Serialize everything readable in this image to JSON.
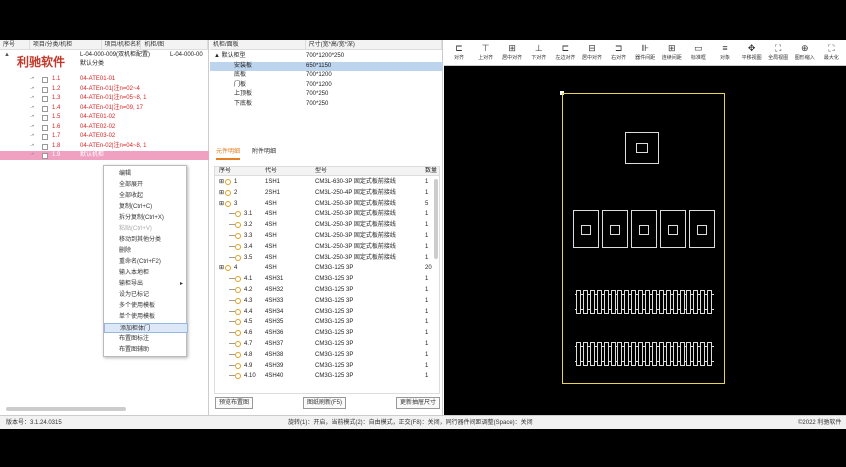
{
  "left": {
    "headers": [
      "序号",
      "项目/分类/机柜",
      "项目/机柜名称",
      "机柜/图"
    ],
    "logo": "利驰软件",
    "project_row": {
      "col1": "L-04-000-009(双机柜配置)",
      "col2": "L-04-000-00"
    },
    "sub_row": "默认分类",
    "rows": [
      {
        "no": "1.1",
        "name": "04-ATE01-01"
      },
      {
        "no": "1.2",
        "name": "04-ATEn-01|注n=02~4"
      },
      {
        "no": "1.3",
        "name": "04-ATEn-01|注n=05~8, 1"
      },
      {
        "no": "1.4",
        "name": "04-ATEn-01|注n=09, 17"
      },
      {
        "no": "1.5",
        "name": "04-ATE01-02"
      },
      {
        "no": "1.6",
        "name": "04-ATE02-02"
      },
      {
        "no": "1.7",
        "name": "04-ATE03-02"
      },
      {
        "no": "1.8",
        "name": "04-ATEn-02|注n=04~8, 1"
      },
      {
        "no": "1.9",
        "name": "默认机柜"
      }
    ]
  },
  "context_menu": {
    "items": [
      {
        "label": "编辑",
        "disabled": false
      },
      {
        "label": "全部展开",
        "disabled": false
      },
      {
        "label": "全部收起",
        "disabled": false
      },
      {
        "label": "复制(Ctrl+C)",
        "disabled": false
      },
      {
        "label": "拆分复制(Ctrl+X)",
        "disabled": false
      },
      {
        "label": "粘贴(Ctrl+V)",
        "disabled": true
      },
      {
        "label": "移动到其他分类",
        "disabled": false
      },
      {
        "label": "删除",
        "disabled": false
      },
      {
        "label": "重命名(Ctrl+F2)",
        "disabled": false
      },
      {
        "label": "输入本地柜",
        "disabled": false
      },
      {
        "label": "输柜导出",
        "disabled": false,
        "submenu": true
      },
      {
        "label": "设为已标记",
        "disabled": false
      },
      {
        "label": "多个使用模板",
        "disabled": false
      },
      {
        "label": "单个使用模板",
        "disabled": false
      },
      {
        "label": "添加柜体门",
        "disabled": false,
        "highlight": true
      },
      {
        "label": "布置图标注",
        "disabled": false
      },
      {
        "label": "布置图辅助",
        "disabled": false
      }
    ]
  },
  "middle": {
    "headers": [
      "机柜/面板",
      "尺寸(宽*高/宽*深)"
    ],
    "rows": [
      {
        "a": "▲ 默认柜型",
        "b": "700*1200*250"
      },
      {
        "a": "安装板",
        "b": "650*1150",
        "selected": true
      },
      {
        "a": "底板",
        "b": "700*1200"
      },
      {
        "a": "门板",
        "b": "700*1200"
      },
      {
        "a": "上顶板",
        "b": "700*250"
      },
      {
        "a": "下底板",
        "b": "700*250"
      }
    ],
    "tabs": [
      "元件明细",
      "附件明细"
    ],
    "table_headers": [
      "序号",
      "代号",
      "型号",
      "数量"
    ],
    "components": [
      {
        "no": "1",
        "code": "1SH1",
        "model": "CM3L-630-3P 固定式板前接线",
        "qty": "1"
      },
      {
        "no": "2",
        "code": "2SH1",
        "model": "CM3L-250-4P 固定式板前接线",
        "qty": "1"
      },
      {
        "no": "3",
        "code": "4SH",
        "model": "CM3L-250-3P 固定式板前接线",
        "qty": "5"
      },
      {
        "no": "3.1",
        "code": "4SH",
        "model": "CM3L-250-3P 固定式板前接线",
        "qty": "1"
      },
      {
        "no": "3.2",
        "code": "4SH",
        "model": "CM3L-250-3P 固定式板前接线",
        "qty": "1"
      },
      {
        "no": "3.3",
        "code": "4SH",
        "model": "CM3L-250-3P 固定式板前接线",
        "qty": "1"
      },
      {
        "no": "3.4",
        "code": "4SH",
        "model": "CM3L-250-3P 固定式板前接线",
        "qty": "1"
      },
      {
        "no": "3.5",
        "code": "4SH",
        "model": "CM3L-250-3P 固定式板前接线",
        "qty": "1"
      },
      {
        "no": "4",
        "code": "4SH",
        "model": "CM3G-125 3P",
        "qty": "20"
      },
      {
        "no": "4.1",
        "code": "4SH31",
        "model": "CM3G-125 3P",
        "qty": "1"
      },
      {
        "no": "4.2",
        "code": "4SH32",
        "model": "CM3G-125 3P",
        "qty": "1"
      },
      {
        "no": "4.3",
        "code": "4SH33",
        "model": "CM3G-125 3P",
        "qty": "1"
      },
      {
        "no": "4.4",
        "code": "4SH34",
        "model": "CM3G-125 3P",
        "qty": "1"
      },
      {
        "no": "4.5",
        "code": "4SH35",
        "model": "CM3G-125 3P",
        "qty": "1"
      },
      {
        "no": "4.6",
        "code": "4SH36",
        "model": "CM3G-125 3P",
        "qty": "1"
      },
      {
        "no": "4.7",
        "code": "4SH37",
        "model": "CM3G-125 3P",
        "qty": "1"
      },
      {
        "no": "4.8",
        "code": "4SH38",
        "model": "CM3G-125 3P",
        "qty": "1"
      },
      {
        "no": "4.9",
        "code": "4SH39",
        "model": "CM3G-125 3P",
        "qty": "1"
      },
      {
        "no": "4.10",
        "code": "4SH40",
        "model": "CM3G-125 3P",
        "qty": "1"
      }
    ],
    "buttons": {
      "prev": "预览布置图",
      "gen": "图纸刷新(F5)",
      "upd": "更新抽屉尺寸"
    }
  },
  "toolbar": [
    "对齐",
    "上对齐",
    "居中对齐",
    "下对齐",
    "左边对齐",
    "居中对齐",
    "右对齐",
    "器件间距",
    "连续间距",
    "标准框",
    "对象",
    "平移视图",
    "全局视图",
    "图形缩入",
    "最大化"
  ],
  "status": {
    "version": "版本号：3.1.24.0315",
    "hint": "旋转(1)：开启，当前模式(2)：自由模式，正交(F8)：关闭，同行器件间距调整(Space)：关闭",
    "copyright": "©2022 利驰软件"
  }
}
